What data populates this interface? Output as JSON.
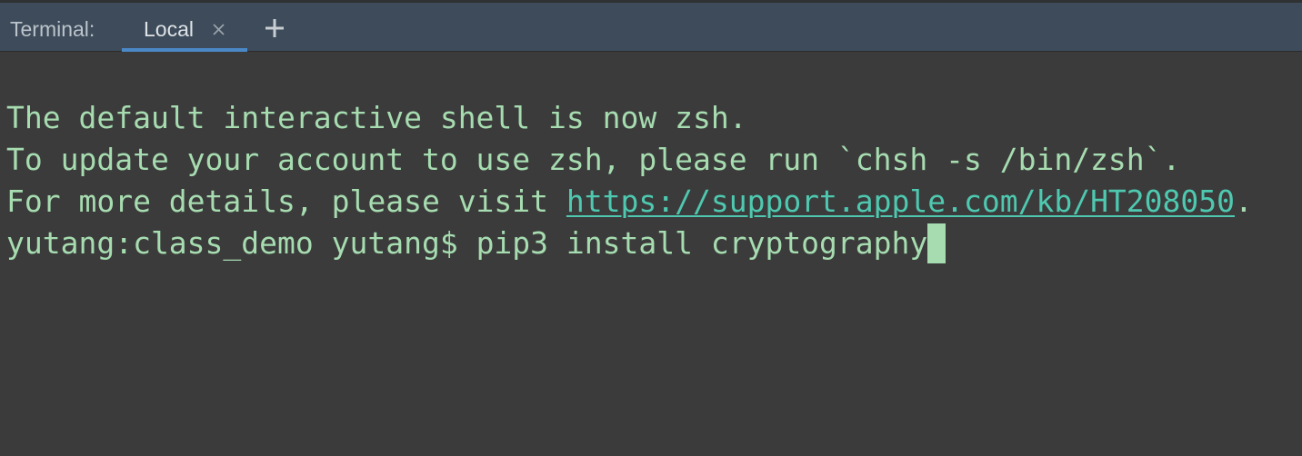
{
  "toolwindow": {
    "title": "Terminal:",
    "tabs": [
      {
        "label": "Local",
        "active": true
      }
    ],
    "new_tab_icon": "plus-icon",
    "close_tab_icon": "close-icon"
  },
  "terminal": {
    "lines": [
      {
        "text": "The default interactive shell is now zsh."
      },
      {
        "text": "To update your account to use zsh, please run `chsh -s /bin/zsh`."
      },
      {
        "prefix": "For more details, please visit ",
        "link": "https://support.apple.com/kb/HT208050",
        "suffix": "."
      },
      {
        "prompt": "yutang:class_demo yutang$ ",
        "command": "pip3 install cryptography"
      }
    ],
    "text_color": "#a6dcb0",
    "link_color": "#4ec9b0",
    "background": "#3b3b3b"
  }
}
